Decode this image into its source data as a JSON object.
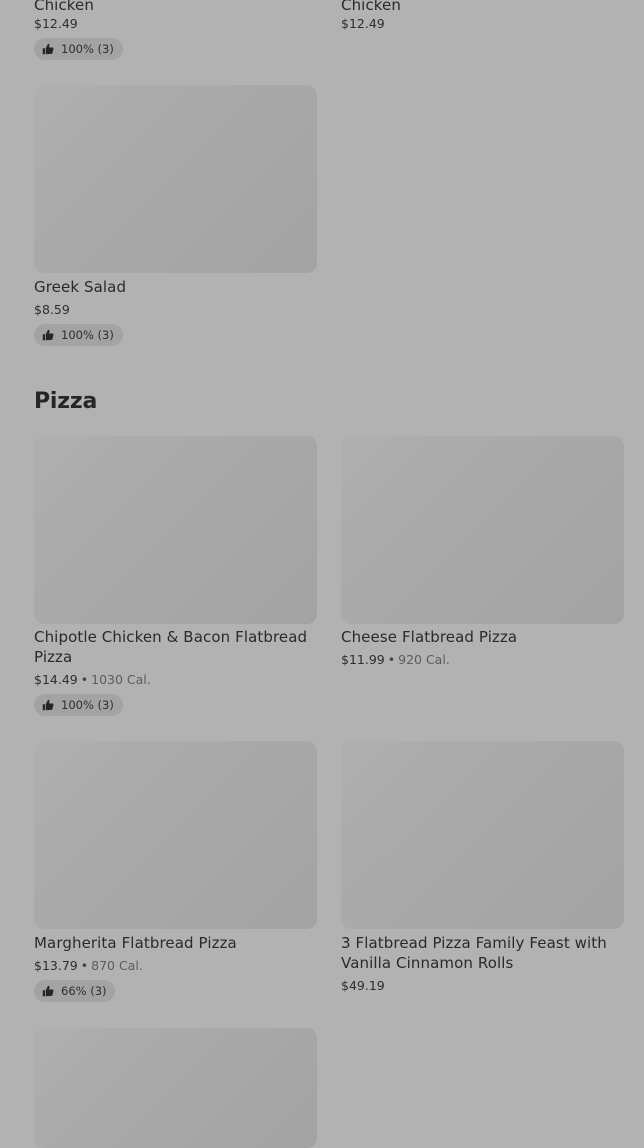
{
  "top_row": [
    {
      "name": "Chicken",
      "price": "$12.49",
      "rating": "100% (3)"
    },
    {
      "name": "Chicken",
      "price": "$12.49"
    }
  ],
  "greek_salad": {
    "name": "Greek Salad",
    "price": "$8.59",
    "rating": "100% (3)"
  },
  "pizza_section": {
    "title": "Pizza",
    "items": [
      {
        "name_line1": "Chipotle Chicken & Bacon Flatbread",
        "name_line2": "Pizza",
        "price": "$14.49",
        "calories": "1030 Cal.",
        "rating": "100% (3)"
      },
      {
        "name": "Cheese Flatbread Pizza",
        "price": "$11.99",
        "calories": "920 Cal."
      },
      {
        "name": "Margherita Flatbread Pizza",
        "price": "$13.79",
        "calories": "870 Cal.",
        "rating": "66% (3)"
      },
      {
        "name_line1": "3 Flatbread Pizza Family Feast with",
        "name_line2": "Vanilla Cinnamon Rolls",
        "price": "$49.19"
      }
    ]
  },
  "separator": "•",
  "icons": {
    "rating": "thumbs-up-icon"
  }
}
